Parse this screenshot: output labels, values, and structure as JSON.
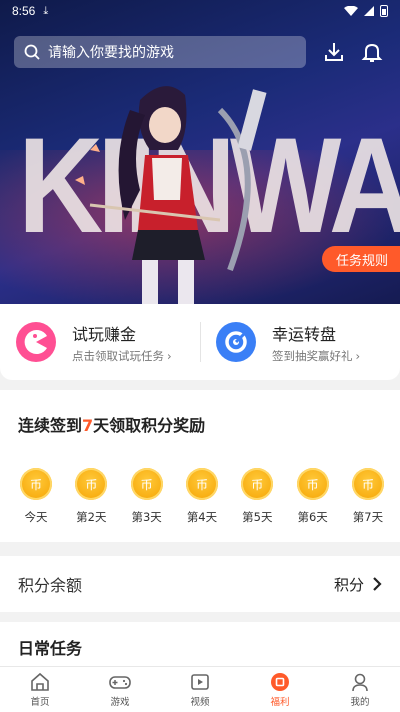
{
  "status_bar": {
    "time": "8:56"
  },
  "search": {
    "placeholder": "请输入你要找的游戏"
  },
  "hero": {
    "rule_button": "任务规则"
  },
  "quick": [
    {
      "title": "试玩赚金",
      "subtitle": "点击领取试玩任务"
    },
    {
      "title": "幸运转盘",
      "subtitle": "签到抽奖赢好礼"
    }
  ],
  "signin": {
    "title_prefix": "连续签到",
    "title_days": "7",
    "title_suffix": "天领取积分奖励",
    "coin_glyph": "币",
    "days": [
      "今天",
      "第2天",
      "第3天",
      "第4天",
      "第5天",
      "第6天",
      "第7天"
    ]
  },
  "balance": {
    "label": "积分余额",
    "value": "积分"
  },
  "daily": {
    "label": "日常任务"
  },
  "tabs": [
    {
      "label": "首页",
      "icon": "home-icon"
    },
    {
      "label": "游戏",
      "icon": "gamepad-icon"
    },
    {
      "label": "视频",
      "icon": "video-icon"
    },
    {
      "label": "福利",
      "icon": "welfare-icon",
      "active": true
    },
    {
      "label": "我的",
      "icon": "profile-icon"
    }
  ],
  "colors": {
    "accent": "#ff5a2a",
    "coin": "#f5a200",
    "pink": "#ff4f93",
    "blue": "#3a7ff6"
  }
}
